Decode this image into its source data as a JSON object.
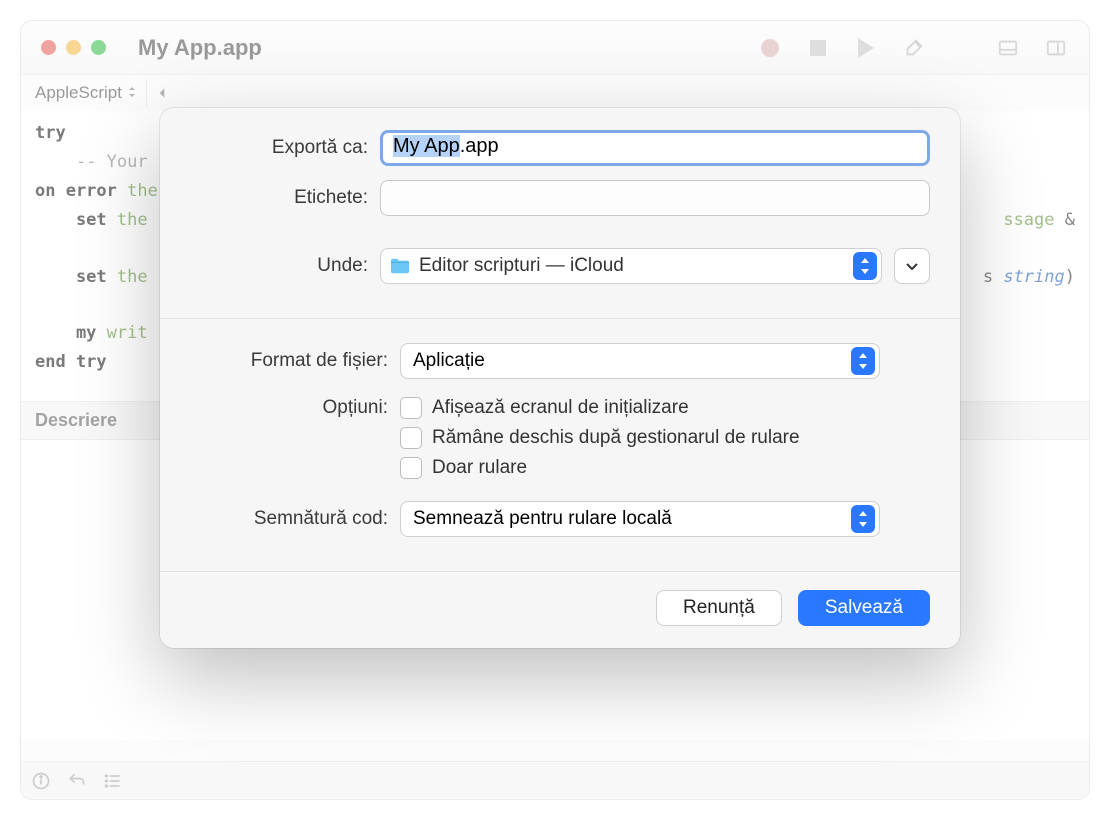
{
  "window": {
    "title": "My App.app",
    "tab_language": "AppleScript"
  },
  "code": {
    "l1_kw": "try",
    "l2": "    -- Your ",
    "l3_kw": "on error",
    "l3_grn": " the",
    "l4_kw": "    set",
    "l4_grn": " the",
    "l4_tail_grn": "ssage",
    "l4_tail_op": " &",
    "l5_kw": "    set",
    "l5_grn": " the",
    "l5_tail_paren": "s ",
    "l5_tail_blu": "string",
    "l5_tail_close": ")",
    "l6_kw": "    my",
    "l6_grn": " writ",
    "l7_kw": "end try"
  },
  "descriere": {
    "header": "Descriere"
  },
  "dialog": {
    "export_label": "Exportă ca:",
    "export_value_sel": "My App",
    "export_value_ext": ".app",
    "tags_label": "Etichete:",
    "tags_value": "",
    "where_label": "Unde:",
    "where_value": "Editor scripturi — iCloud",
    "format_label": "Format de fișier:",
    "format_value": "Aplicație",
    "options_label": "Opțiuni:",
    "opt1": "Afișează ecranul de inițializare",
    "opt2": "Rămâne deschis după gestionarul de rulare",
    "opt3": "Doar rulare",
    "sign_label": "Semnătură cod:",
    "sign_value": "Semnează pentru rulare locală",
    "cancel": "Renunță",
    "save": "Salvează"
  }
}
